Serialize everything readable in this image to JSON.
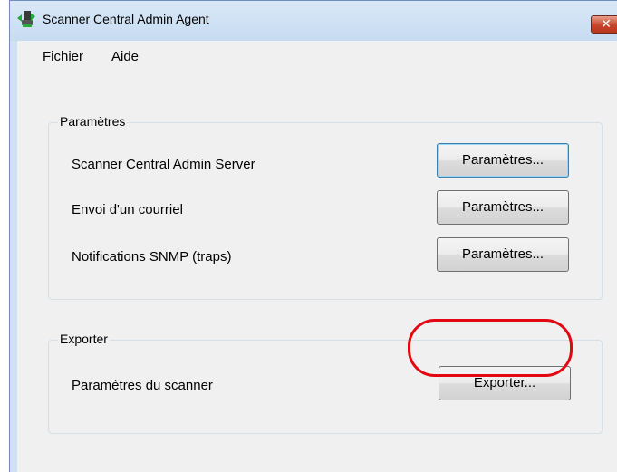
{
  "window": {
    "title": "Scanner Central Admin Agent",
    "close_glyph": "✕",
    "app_icon": "scanner-app-icon"
  },
  "menu": [
    "Fichier",
    "Aide"
  ],
  "settings_group": {
    "title": "Paramètres",
    "rows": [
      {
        "label": "Scanner Central Admin Server",
        "button": "Paramètres..."
      },
      {
        "label": "Envoi d'un courriel",
        "button": "Paramètres..."
      },
      {
        "label": "Notifications SNMP (traps)",
        "button": "Paramètres..."
      }
    ]
  },
  "export_group": {
    "title": "Exporter",
    "rows": [
      {
        "label": "Paramètres du scanner",
        "button": "Exporter..."
      }
    ]
  },
  "colors": {
    "highlight": "#e30613",
    "title_bar": "#cfe0f3",
    "close_button": "#c7452a"
  }
}
